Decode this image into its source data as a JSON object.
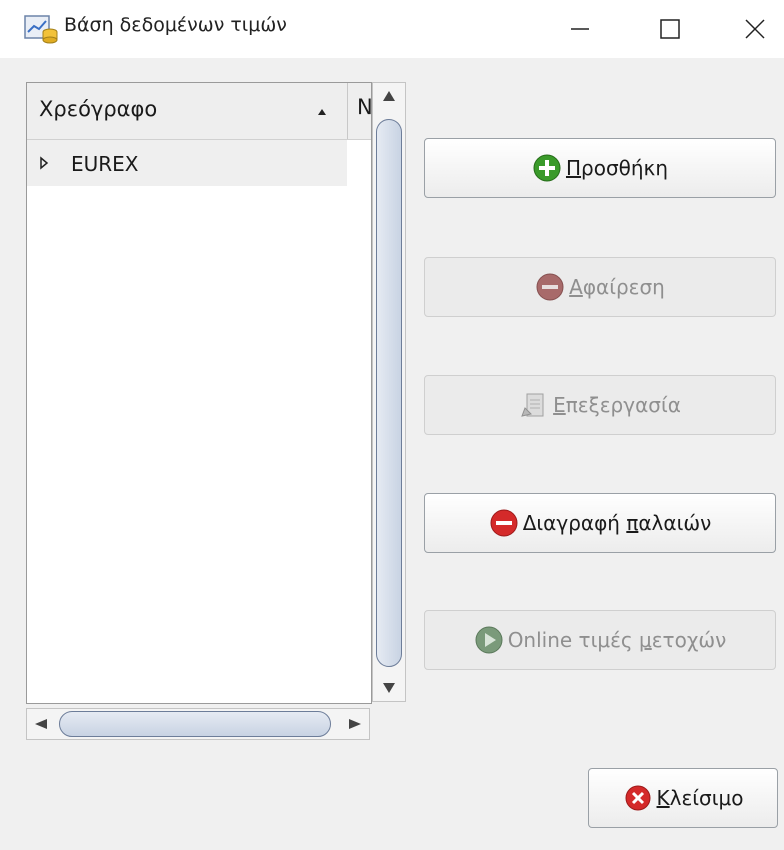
{
  "window": {
    "title": "Βάση δεδομένων τιμών",
    "app_icon": "database-chart-icon"
  },
  "tree": {
    "columns": [
      "Χρεόγραφο",
      "Ν"
    ],
    "sort_column": "Χρεόγραφο",
    "sort_direction": "ascending",
    "rows": [
      {
        "label": "EUREX",
        "expanded": false
      }
    ]
  },
  "buttons": {
    "add": {
      "label_pre": "",
      "label_u": "Π",
      "label_post": "ροσθήκη",
      "icon": "plus-circle-icon",
      "enabled": true
    },
    "remove": {
      "label_pre": "",
      "label_u": "Α",
      "label_post": "φαίρεση",
      "icon": "minus-circle-icon",
      "enabled": false
    },
    "edit": {
      "label_pre": "",
      "label_u": "Ε",
      "label_post": "πεξεργασία",
      "icon": "edit-document-icon",
      "enabled": false
    },
    "delete_old": {
      "label_pre": "Διαγραφή ",
      "label_u": "π",
      "label_post": "αλαιών",
      "icon": "minus-circle-icon",
      "enabled": true
    },
    "online": {
      "label_pre": "Online τιμές ",
      "label_u": "μ",
      "label_post": "ετοχών",
      "icon": "play-circle-icon",
      "enabled": false
    },
    "close": {
      "label_pre": "",
      "label_u": "Κ",
      "label_post": "λείσιμο",
      "icon": "close-circle-icon",
      "enabled": true
    }
  },
  "colors": {
    "add_icon": "#3a9a2a",
    "delete_icon": "#d42a2a",
    "close_icon": "#d42a2a",
    "disabled_text": "#8f8f8f"
  }
}
